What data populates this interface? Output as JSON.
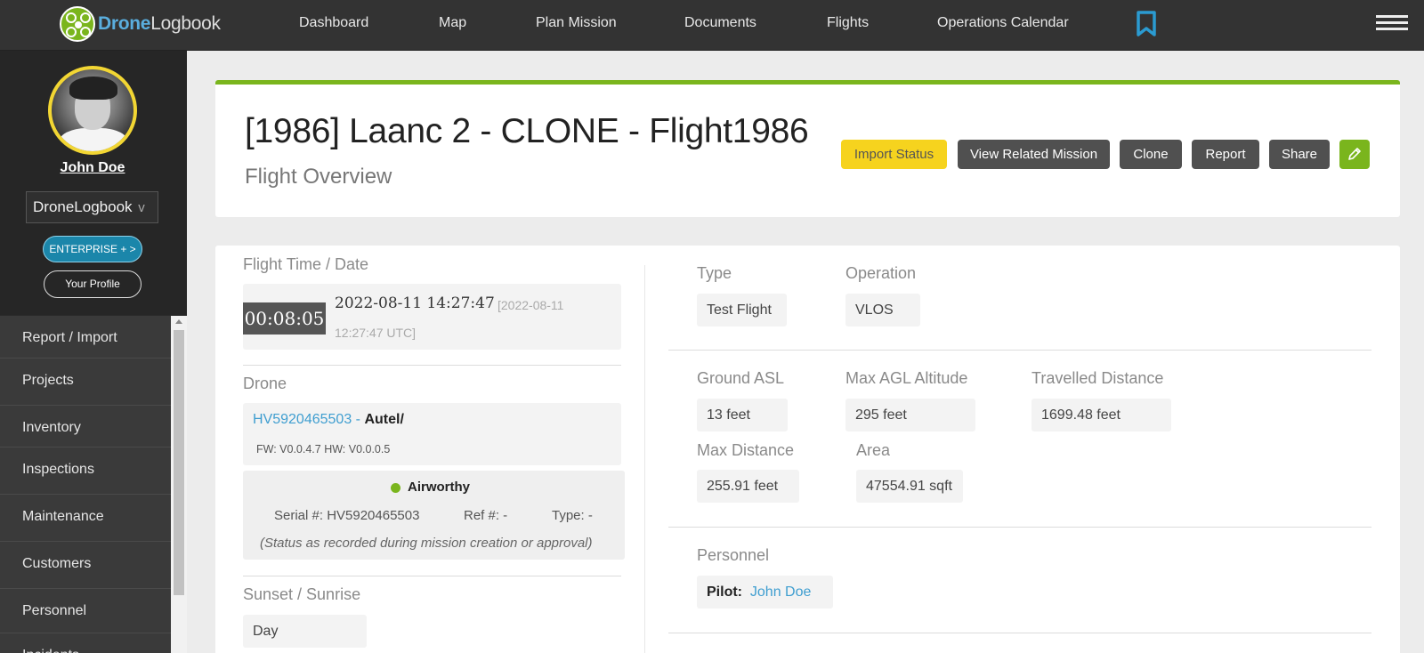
{
  "brand": {
    "highlight": "Drone",
    "rest": "Logbook"
  },
  "nav": {
    "items": [
      "Dashboard",
      "Map",
      "Plan Mission",
      "Documents",
      "Flights",
      "Operations Calendar"
    ],
    "bookmark_icon": "bookmark-icon",
    "menu_icon": "hamburger-icon"
  },
  "sidebar": {
    "user_name": "John Doe",
    "org_select": "DroneLogbook",
    "org_chevron": "v",
    "enterprise_label": "ENTERPRISE + >",
    "profile_label": "Your Profile",
    "menu": [
      "Report / Import",
      "Projects",
      "Inventory",
      "Inspections",
      "Maintenance",
      "Customers",
      "Personnel",
      "Incidents"
    ]
  },
  "header": {
    "title": "[1986] Laanc 2 - CLONE - Flight1986",
    "subtitle": "Flight Overview",
    "buttons": {
      "import_status": "Import Status",
      "view_related": "View Related Mission",
      "clone": "Clone",
      "report": "Report",
      "share": "Share"
    },
    "edit_icon": "pencil-icon"
  },
  "flight_time": {
    "label": "Flight Time / Date",
    "duration": "00:08:05",
    "local": "2022-08-11 14:27:47",
    "utc_line1": "[2022-08-11",
    "utc_line2": "12:27:47 UTC]"
  },
  "drone": {
    "label": "Drone",
    "serial_link": "HV5920465503",
    "separator": "-",
    "model": "Autel/",
    "firmware": "FW: V0.0.4.7 HW: V0.0.0.5",
    "status": "Airworthy",
    "serial": "Serial #: HV5920465503",
    "ref": "Ref #: -",
    "type": "Type: -",
    "note": "(Status as recorded during mission creation or approval)"
  },
  "sunset": {
    "label": "Sunset / Sunrise",
    "value": "Day"
  },
  "details": {
    "type": {
      "label": "Type",
      "value": "Test Flight"
    },
    "operation": {
      "label": "Operation",
      "value": "VLOS"
    },
    "ground_asl": {
      "label": "Ground ASL",
      "value": "13 feet"
    },
    "max_agl": {
      "label": "Max AGL Altitude",
      "value": "295 feet"
    },
    "travelled": {
      "label": "Travelled Distance",
      "value": "1699.48 feet"
    },
    "max_distance": {
      "label": "Max Distance",
      "value": "255.91 feet"
    },
    "area": {
      "label": "Area",
      "value": "47554.91 sqft"
    }
  },
  "personnel": {
    "label": "Personnel",
    "pilot_label": "Pilot:",
    "pilot_name": "John Doe"
  },
  "colors": {
    "accent_green": "#7ab51d",
    "link_blue": "#3f9ed0",
    "warning_yellow": "#f6d31e",
    "nav_dark": "#333333"
  }
}
